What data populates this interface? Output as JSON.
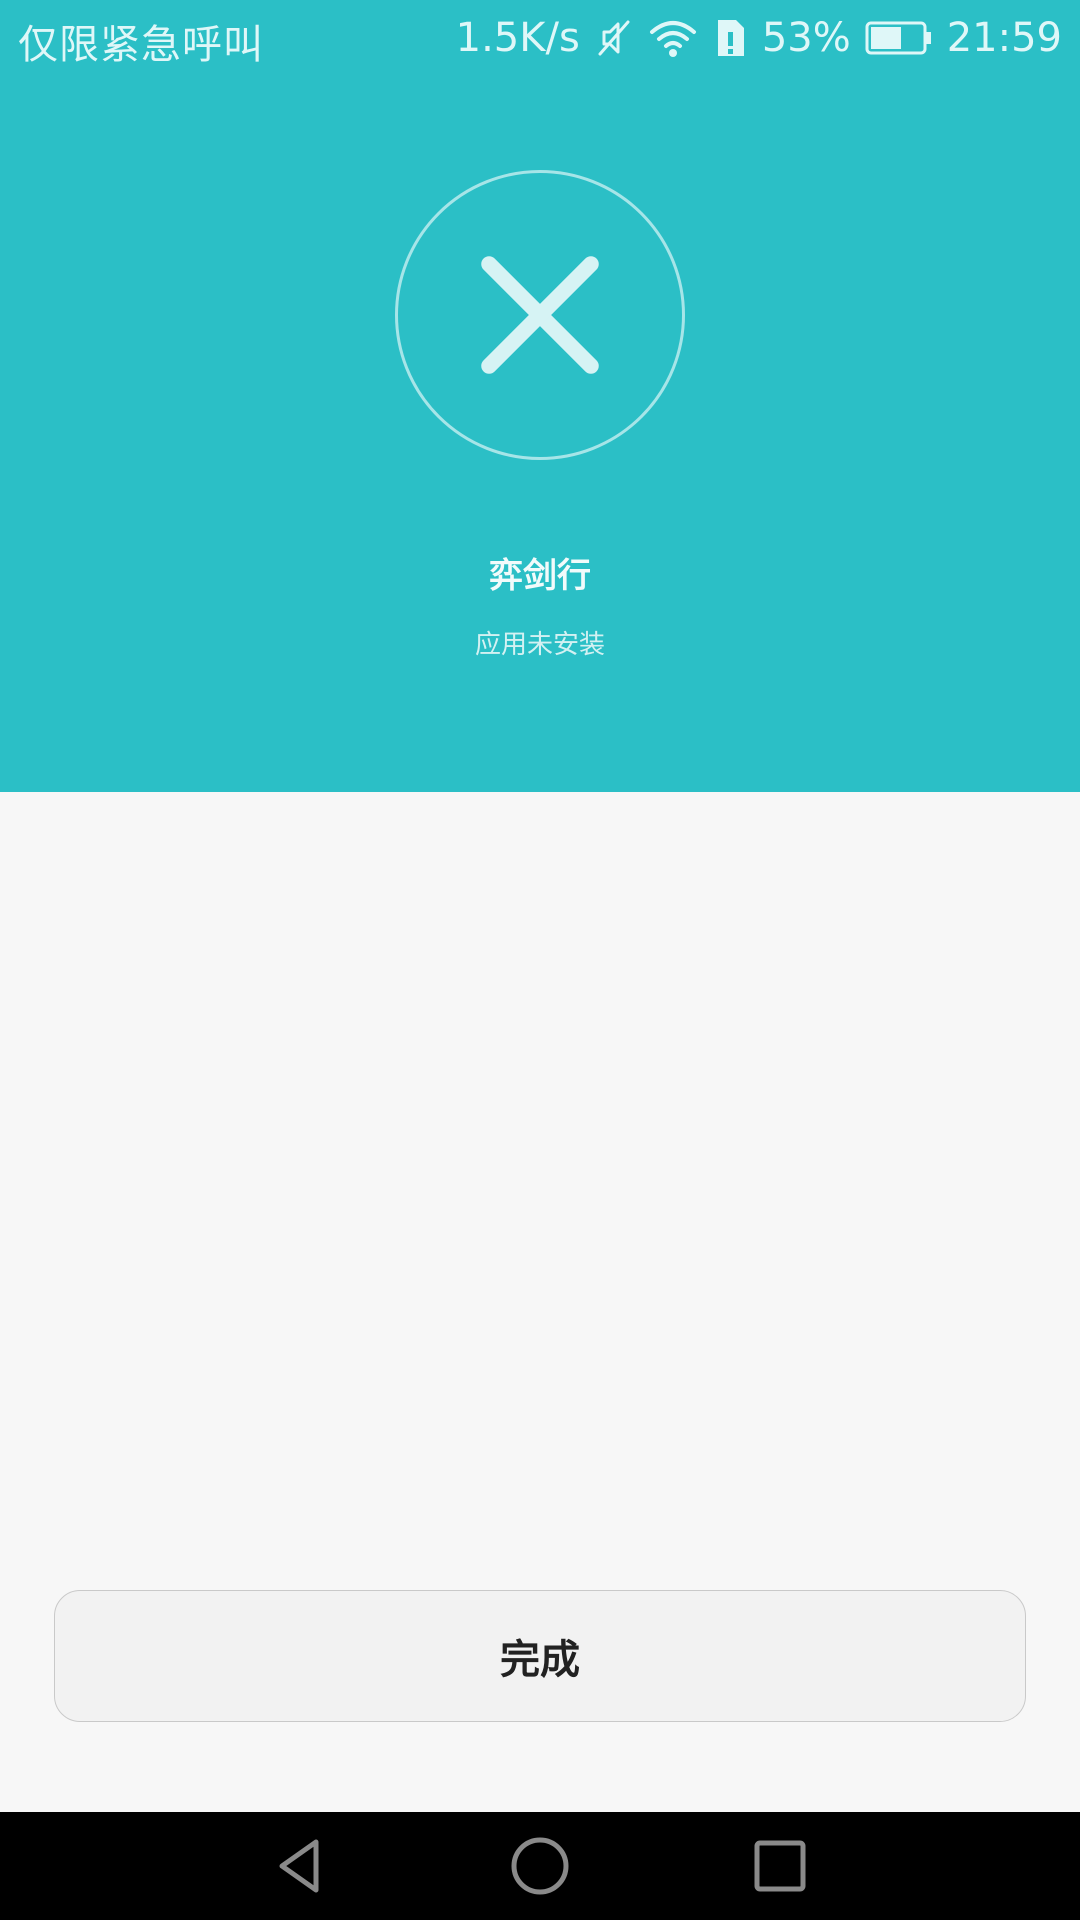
{
  "status_bar": {
    "carrier": "仅限紧急呼叫",
    "net_speed": "1.5K/s",
    "battery_percent": "53%",
    "time": "21:59",
    "icons": [
      "mute-icon",
      "wifi-icon",
      "sim-alert-icon",
      "battery-icon"
    ]
  },
  "result": {
    "icon": "close-icon",
    "app_name": "弈剑行",
    "message": "应用未安装"
  },
  "actions": {
    "done_label": "完成"
  },
  "nav_bar": {
    "buttons": [
      "back-icon",
      "home-icon",
      "recent-apps-icon"
    ]
  },
  "colors": {
    "header_bg": "#2bbfc6",
    "page_bg": "#f7f7f7",
    "nav_bg": "#000000"
  }
}
